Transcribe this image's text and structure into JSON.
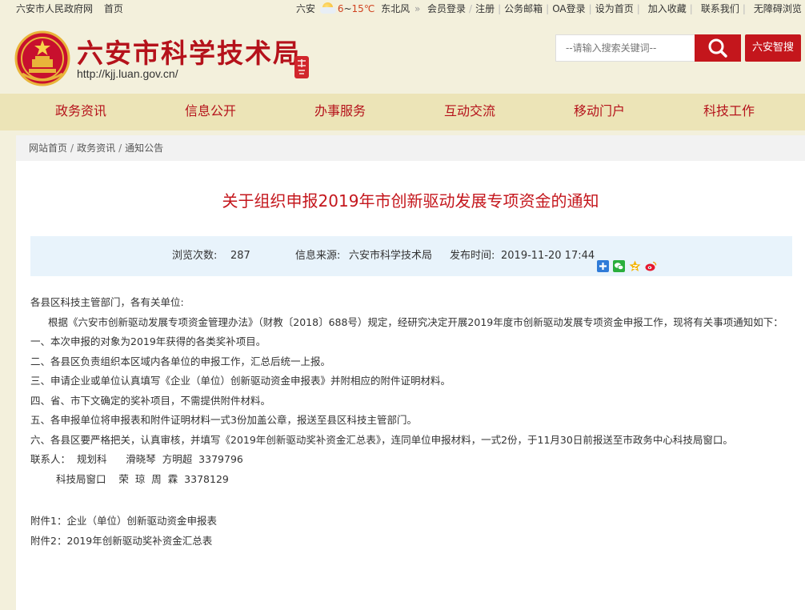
{
  "topbar": {
    "left_links": [
      "六安市人民政府网",
      "首页"
    ],
    "weather_city": "六安",
    "temp_low": "6",
    "temp_tilde": "~",
    "temp_high": "15℃",
    "wind": "东北风",
    "more_arrow": "»",
    "links": [
      "会员登录",
      "注册",
      "公务邮箱",
      "OA登录",
      "设为首页",
      "加入收藏",
      "联系我们",
      "无障碍浏览"
    ]
  },
  "header": {
    "site_title": "六安市科学技术局",
    "site_url": "http://kjj.luan.gov.cn/",
    "search_placeholder": "--请输入搜索关键词--",
    "smart_button": "六安智搜"
  },
  "nav": [
    "政务资讯",
    "信息公开",
    "办事服务",
    "互动交流",
    "移动门户",
    "科技工作"
  ],
  "breadcrumb": [
    "网站首页",
    "政务资讯",
    "通知公告"
  ],
  "article": {
    "title": "关于组织申报2019年市创新驱动发展专项资金的通知",
    "views_label": "浏览次数:",
    "views": "287",
    "source_label": "信息来源:",
    "source": "六安市科学技术局",
    "date_label": "发布时间:",
    "date": "2019-11-20 17:44",
    "paragraphs": [
      "各县区科技主管部门，各有关单位:",
      "根据《六安市创新驱动发展专项资金管理办法》（财教〔2018〕688号）规定，经研究决定开展2019年度市创新驱动发展专项资金申报工作，现将有关事项通知如下：",
      "一、本次申报的对象为2019年获得的各类奖补项目。",
      "二、各县区负责组织本区域内各单位的申报工作，汇总后统一上报。",
      "三、申请企业或单位认真填写《企业（单位）创新驱动资金申报表》并附相应的附件证明材料。",
      "四、省、市下文确定的奖补项目，不需提供附件材料。",
      "五、各申报单位将申报表和附件证明材料一式3份加盖公章，报送至县区科技主管部门。",
      "六、各县区要严格把关，认真审核，并填写《2019年创新驱动奖补资金汇总表》，连同单位申报材料，一式2份，于11月30日前报送至市政务中心科技局窗口。",
      "联系人：  规划科      滑晓琴  方明超  3379796",
      "科技局窗口    荣  琼  周  霖  3378129",
      "附件1：企业（单位）创新驱动资金申报表",
      "附件2：2019年创新驱动奖补资金汇总表"
    ]
  },
  "colors": {
    "brand_red": "#c4161c",
    "page_bg": "#f3f0dc",
    "nav_bg": "#ece4b7",
    "info_bg": "#e8f3fb"
  },
  "icons": [
    "sun-cloud-icon",
    "search-icon",
    "plus-share-icon",
    "wechat-icon",
    "qzone-icon",
    "weibo-icon"
  ]
}
